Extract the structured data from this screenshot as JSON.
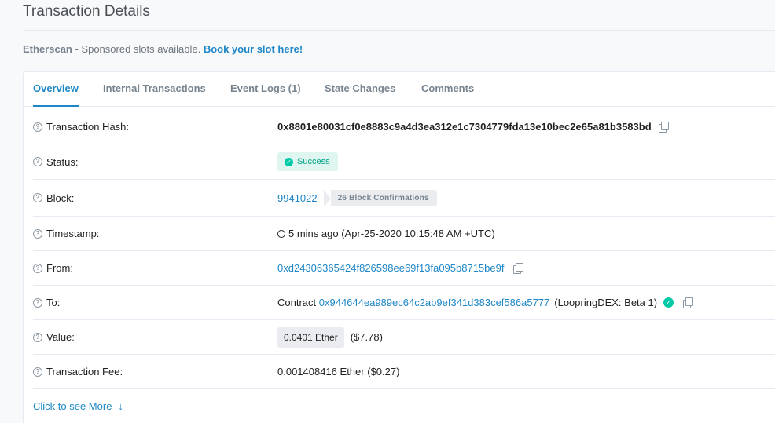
{
  "page": {
    "title": "Transaction Details"
  },
  "sponsor": {
    "brand": "Etherscan",
    "text": " - Sponsored slots available. ",
    "cta": "Book your slot here!"
  },
  "tabs": [
    {
      "label": "Overview",
      "active": true
    },
    {
      "label": "Internal Transactions",
      "active": false
    },
    {
      "label": "Event Logs (1)",
      "active": false
    },
    {
      "label": "State Changes",
      "active": false
    },
    {
      "label": "Comments",
      "active": false
    }
  ],
  "help_icon": "?",
  "rows": {
    "hash": {
      "label": "Transaction Hash:",
      "value": "0x8801e80031cf0e8883c9a4d3ea312e1c7304779fda13e10bec2e65a81b3583bd"
    },
    "status": {
      "label": "Status:",
      "value": "Success",
      "icon": "check-circle-icon"
    },
    "block": {
      "label": "Block:",
      "value": "9941022",
      "confirmations": "26 Block Confirmations"
    },
    "timestamp": {
      "label": "Timestamp:",
      "value": "5 mins ago (Apr-25-2020 10:15:48 AM +UTC)"
    },
    "from": {
      "label": "From:",
      "value": "0xd24306365424f826598ee69f13fa095b8715be9f"
    },
    "to": {
      "label": "To:",
      "prefix": "Contract ",
      "address": "0x944644ea989ec64c2ab9ef341d383cef586a5777",
      "name": "(LoopringDEX: Beta 1)"
    },
    "value": {
      "label": "Value:",
      "amount": "0.0401 Ether",
      "usd": "($7.78)"
    },
    "fee": {
      "label": "Transaction Fee:",
      "value": "0.001408416 Ether ($0.27)"
    }
  },
  "more": {
    "label": "Click to see More",
    "arrow": "↓"
  },
  "colors": {
    "accent": "#1e87c7",
    "success": "#00c9a7",
    "success_bg": "#dff5ef"
  }
}
